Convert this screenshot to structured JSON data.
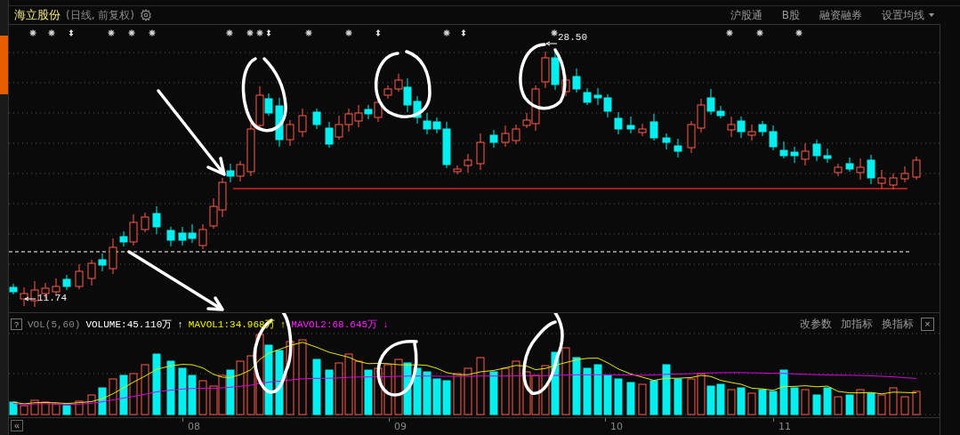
{
  "header": {
    "stock_name": "海立股份",
    "period": "(日线, 前复权)",
    "links": [
      "沪股通",
      "B股",
      "融资融券"
    ],
    "ma_setting": "设置均线"
  },
  "price_labels": {
    "high": "28.50",
    "low": "11.74"
  },
  "volume_panel": {
    "help": "?",
    "indicator": "VOL(5,60)",
    "volume": "VOLUME:45.110万",
    "volume_trend": "↑",
    "mavol1": "MAVOL1:34.968万",
    "mavol1_trend": "↑",
    "mavol2": "MAVOL2:68.645万",
    "mavol2_trend": "↓",
    "actions": [
      "改参数",
      "加指标",
      "换指标"
    ],
    "close": "×"
  },
  "x_axis": {
    "back": "«",
    "months": [
      "08",
      "09",
      "10",
      "11"
    ]
  }
}
